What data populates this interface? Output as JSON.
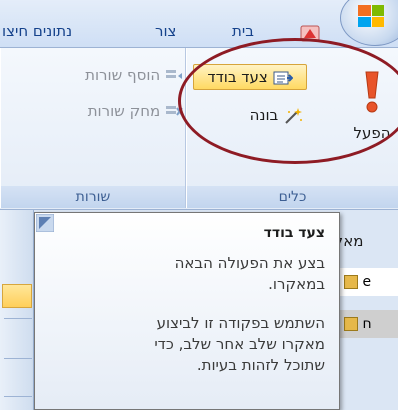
{
  "tabs": [
    {
      "label": "נתונים חיצו"
    },
    {
      "label": "צור"
    },
    {
      "label": "בית"
    }
  ],
  "ribbon": {
    "groups": [
      {
        "label": "שורות",
        "buttons": [
          {
            "label": "הוסף שורות"
          },
          {
            "label": "מחק שורות"
          }
        ]
      },
      {
        "label": "כלים",
        "buttons": [
          {
            "label": "צעד בודד"
          },
          {
            "label": "בונה"
          },
          {
            "label": "הפעל"
          }
        ]
      }
    ]
  },
  "pane": {
    "title": "מאקרו",
    "rows": [
      {
        "text": "e"
      },
      {
        "text": "ח"
      }
    ]
  },
  "tooltip": {
    "title": "צעד בודד",
    "line1": "בצע את הפעולה הבאה במאקרו.",
    "line2": "השתמש בפקודה זו לביצוע מאקרו שלב אחר שלב, כדי שתוכל לזהות בעיות."
  },
  "colors": {
    "annotation": "#8e1b24",
    "run_icon": "#e8542a",
    "highlight": "#ffd962"
  }
}
